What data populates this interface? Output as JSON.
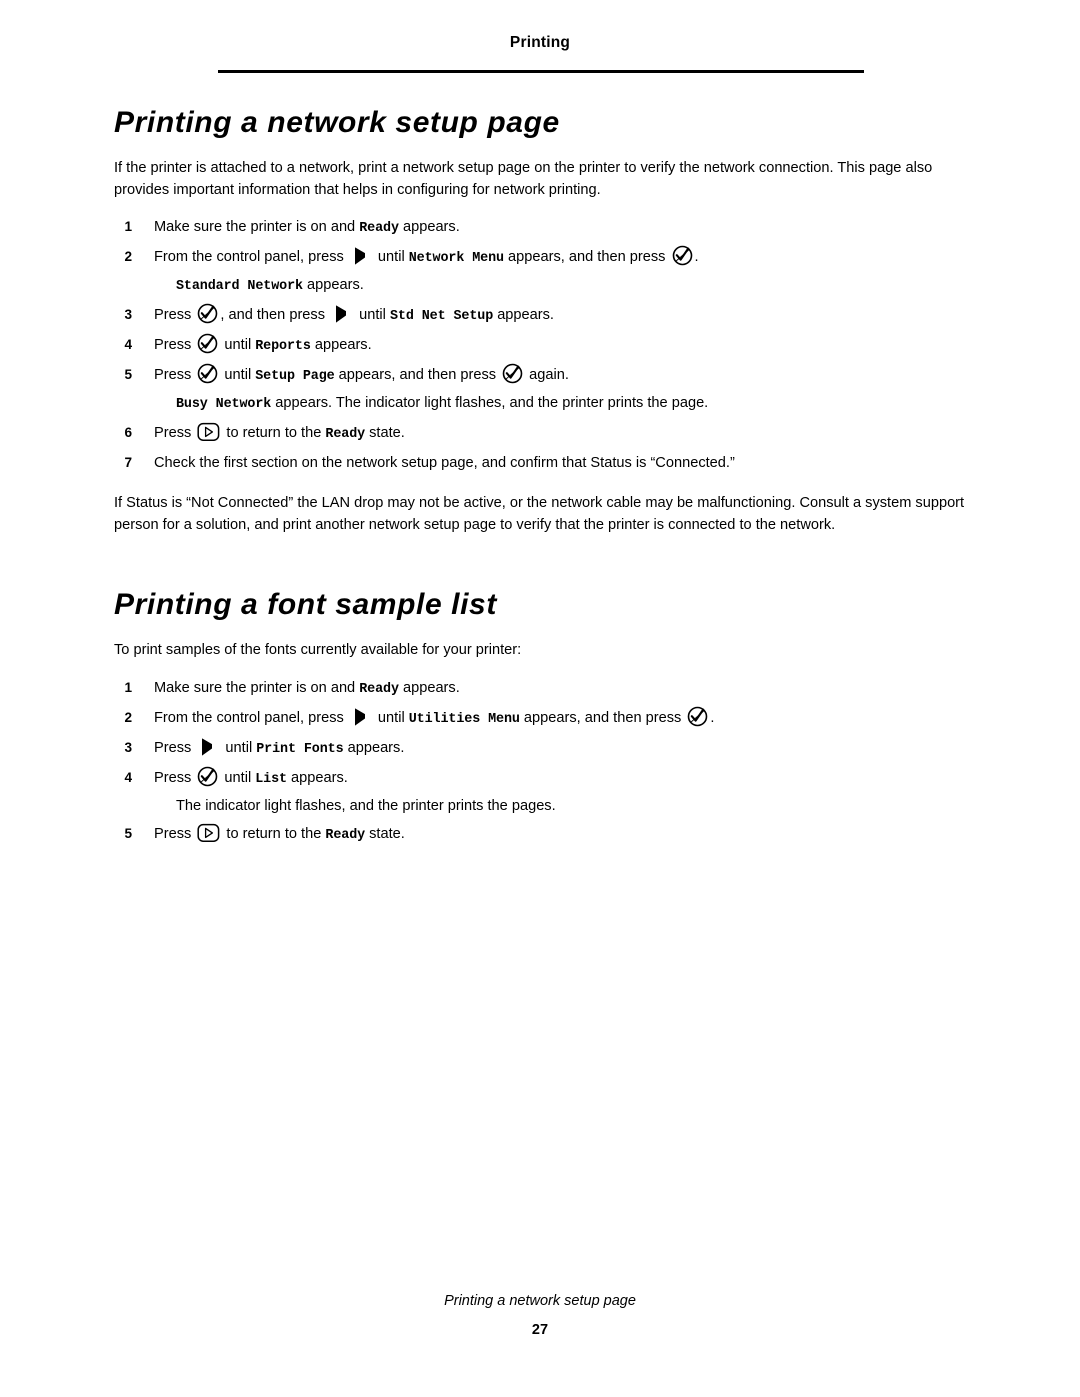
{
  "header": {
    "title": "Printing"
  },
  "section1": {
    "heading": "Printing a network setup page",
    "intro": "If the printer is attached to a network, print a network setup page on the printer to verify the network connection. This page also provides important information that helps in configuring for network printing.",
    "steps": [
      {
        "num": "1",
        "parts": [
          {
            "t": "text",
            "v": "Make sure the printer is on and "
          },
          {
            "t": "mono",
            "v": "Ready"
          },
          {
            "t": "text",
            "v": " appears."
          }
        ]
      },
      {
        "num": "2",
        "parts": [
          {
            "t": "text",
            "v": "From the control panel, press "
          },
          {
            "t": "icon",
            "v": "arrow-icon"
          },
          {
            "t": "text",
            "v": " until "
          },
          {
            "t": "mono",
            "v": "Network Menu"
          },
          {
            "t": "text",
            "v": " appears, and then press "
          },
          {
            "t": "icon",
            "v": "select-icon"
          },
          {
            "t": "text",
            "v": "."
          }
        ],
        "sub": [
          {
            "t": "mono",
            "v": "Standard Network"
          },
          {
            "t": "text",
            "v": " appears."
          }
        ]
      },
      {
        "num": "3",
        "parts": [
          {
            "t": "text",
            "v": "Press "
          },
          {
            "t": "icon",
            "v": "select-icon"
          },
          {
            "t": "text",
            "v": ", and then press "
          },
          {
            "t": "icon",
            "v": "arrow-icon"
          },
          {
            "t": "text",
            "v": " until "
          },
          {
            "t": "mono",
            "v": "Std Net Setup"
          },
          {
            "t": "text",
            "v": " appears."
          }
        ]
      },
      {
        "num": "4",
        "parts": [
          {
            "t": "text",
            "v": "Press "
          },
          {
            "t": "icon",
            "v": "select-icon"
          },
          {
            "t": "text",
            "v": " until "
          },
          {
            "t": "mono",
            "v": "Reports"
          },
          {
            "t": "text",
            "v": " appears."
          }
        ]
      },
      {
        "num": "5",
        "parts": [
          {
            "t": "text",
            "v": "Press "
          },
          {
            "t": "icon",
            "v": "select-icon"
          },
          {
            "t": "text",
            "v": " until "
          },
          {
            "t": "mono",
            "v": "Setup Page"
          },
          {
            "t": "text",
            "v": " appears, and then press "
          },
          {
            "t": "icon",
            "v": "select-icon"
          },
          {
            "t": "text",
            "v": " again."
          }
        ],
        "sub": [
          {
            "t": "mono",
            "v": "Busy Network"
          },
          {
            "t": "text",
            "v": " appears. The indicator light flashes, and the printer prints the page."
          }
        ]
      },
      {
        "num": "6",
        "parts": [
          {
            "t": "text",
            "v": "Press "
          },
          {
            "t": "icon",
            "v": "back-icon"
          },
          {
            "t": "text",
            "v": " to return to the "
          },
          {
            "t": "mono",
            "v": "Ready"
          },
          {
            "t": "text",
            "v": " state."
          }
        ]
      },
      {
        "num": "7",
        "parts": [
          {
            "t": "text",
            "v": "Check the first section on the network setup page, and confirm that Status is “Connected.”"
          }
        ]
      }
    ],
    "closing": "If Status is “Not Connected” the LAN drop may not be active, or the network cable may be malfunctioning. Consult a system support person for a solution, and print another network setup page to verify that the printer is connected to the network."
  },
  "section2": {
    "heading": "Printing a font sample list",
    "intro": "To print samples of the fonts currently available for your printer:",
    "steps": [
      {
        "num": "1",
        "parts": [
          {
            "t": "text",
            "v": "Make sure the printer is on and "
          },
          {
            "t": "mono",
            "v": "Ready"
          },
          {
            "t": "text",
            "v": " appears."
          }
        ]
      },
      {
        "num": "2",
        "parts": [
          {
            "t": "text",
            "v": "From the control panel, press "
          },
          {
            "t": "icon",
            "v": "arrow-icon"
          },
          {
            "t": "text",
            "v": " until "
          },
          {
            "t": "mono",
            "v": "Utilities Menu"
          },
          {
            "t": "text",
            "v": " appears, and then press "
          },
          {
            "t": "icon",
            "v": "select-icon"
          },
          {
            "t": "text",
            "v": "."
          }
        ]
      },
      {
        "num": "3",
        "parts": [
          {
            "t": "text",
            "v": "Press "
          },
          {
            "t": "icon",
            "v": "arrow-icon"
          },
          {
            "t": "text",
            "v": " until "
          },
          {
            "t": "mono",
            "v": "Print Fonts"
          },
          {
            "t": "text",
            "v": " appears."
          }
        ]
      },
      {
        "num": "4",
        "parts": [
          {
            "t": "text",
            "v": "Press "
          },
          {
            "t": "icon",
            "v": "select-icon"
          },
          {
            "t": "text",
            "v": " until "
          },
          {
            "t": "mono",
            "v": "List"
          },
          {
            "t": "text",
            "v": " appears."
          }
        ],
        "sub": [
          {
            "t": "text",
            "v": "The indicator light flashes, and the printer prints the pages."
          }
        ]
      },
      {
        "num": "5",
        "parts": [
          {
            "t": "text",
            "v": "Press "
          },
          {
            "t": "icon",
            "v": "back-icon"
          },
          {
            "t": "text",
            "v": " to return to the "
          },
          {
            "t": "mono",
            "v": "Ready"
          },
          {
            "t": "text",
            "v": " state."
          }
        ]
      }
    ]
  },
  "footer": {
    "title": "Printing a network setup page",
    "page_number": "27"
  }
}
